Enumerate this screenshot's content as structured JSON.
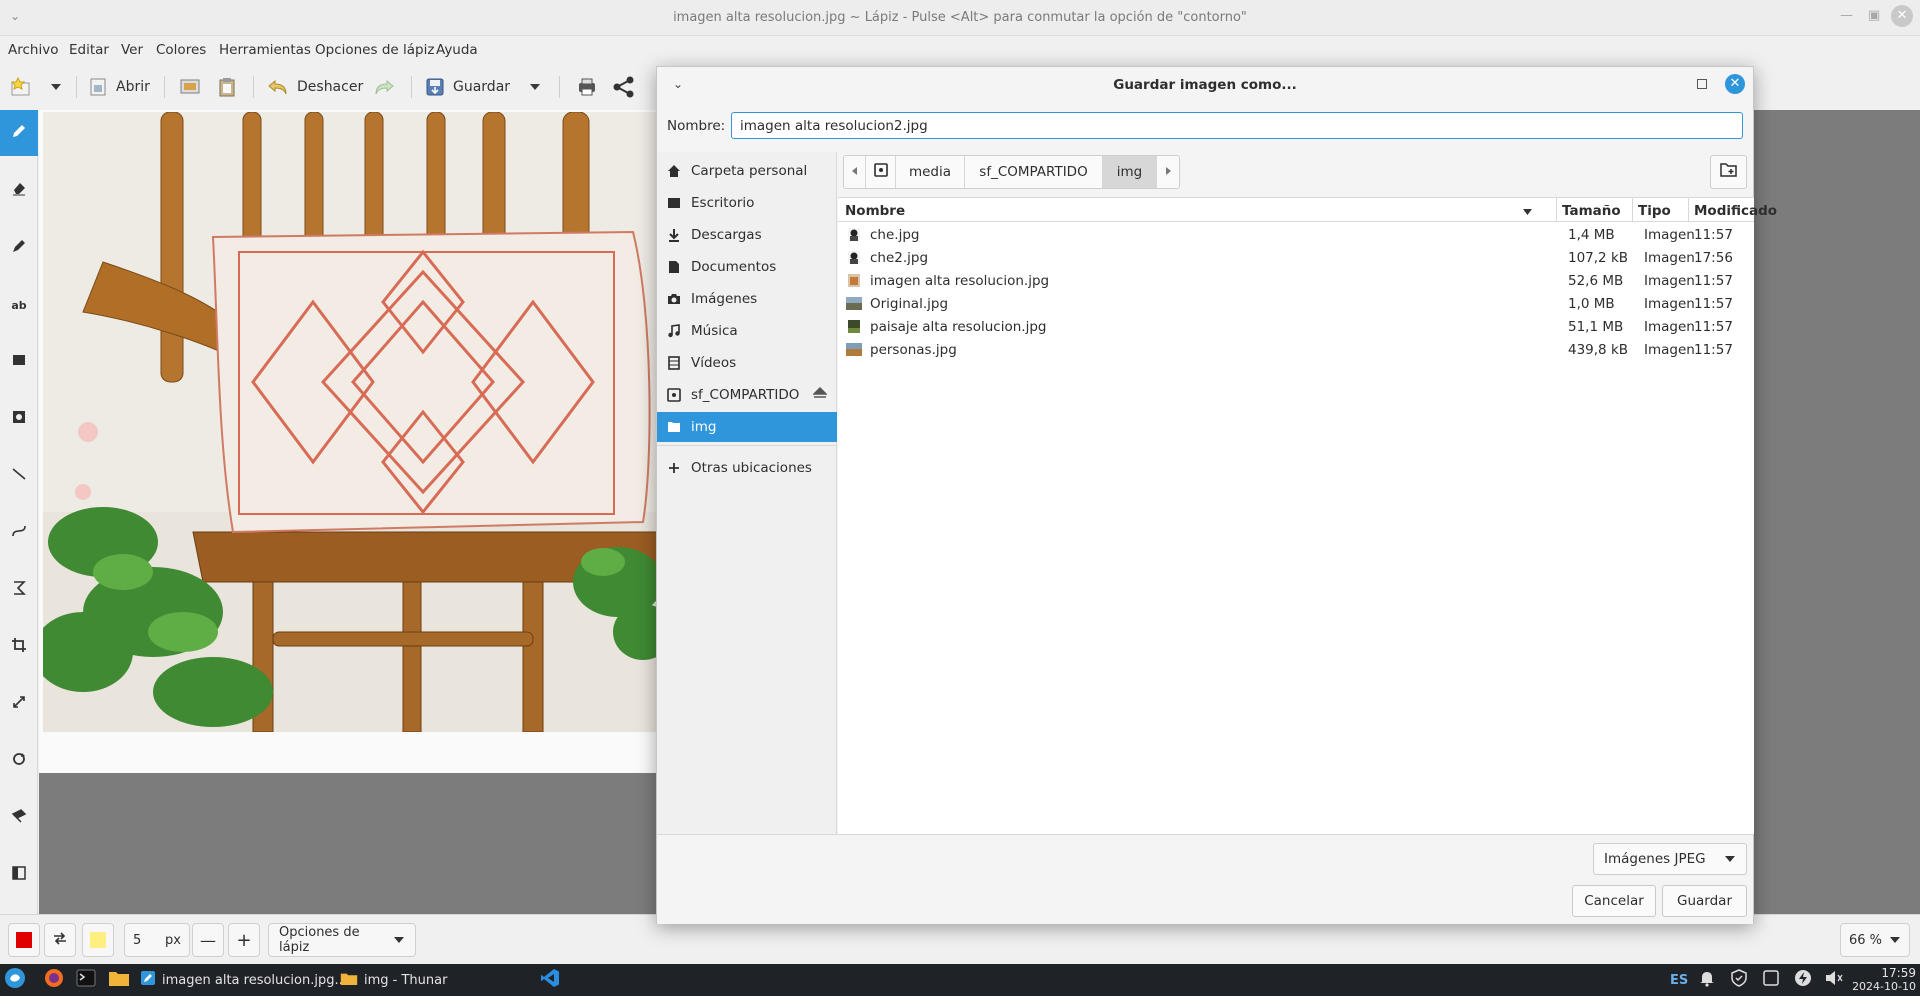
{
  "window": {
    "title": "imagen alta resolucion.jpg ~ Lápiz - Pulse <Alt> para conmutar la opción de \"contorno\""
  },
  "menu": [
    "Archivo",
    "Editar",
    "Ver",
    "Colores",
    "Herramientas",
    "Opciones de lápiz",
    "Ayuda"
  ],
  "toolbar": {
    "open_label": "Abrir",
    "undo_label": "Deshacer",
    "save_label": "Guardar"
  },
  "tools": [
    "pencil-tool",
    "eraser-tool",
    "highlighter-tool",
    "text-tool",
    "rectangle-tool",
    "shape-tool",
    "line-tool",
    "curve-tool",
    "scale-tool",
    "crop-tool",
    "resize-tool",
    "rotate-tool",
    "skew-tool",
    "filters-tool"
  ],
  "options_bar": {
    "size_value": "5",
    "size_unit": "px",
    "tool_options_label": "Opciones de lápiz",
    "zoom_value": "66 %",
    "primary_color": "#e00000",
    "secondary_color": "#ffee80"
  },
  "dialog": {
    "title": "Guardar imagen como...",
    "name_label": "Nombre:",
    "name_value": "imagen alta resolucion2.jpg",
    "places": [
      {
        "label": "Carpeta personal",
        "icon": "home-icon"
      },
      {
        "label": "Escritorio",
        "icon": "desktop-icon"
      },
      {
        "label": "Descargas",
        "icon": "download-icon"
      },
      {
        "label": "Documentos",
        "icon": "document-icon"
      },
      {
        "label": "Imágenes",
        "icon": "camera-icon"
      },
      {
        "label": "Música",
        "icon": "music-icon"
      },
      {
        "label": "Vídeos",
        "icon": "film-icon"
      },
      {
        "label": "sf_COMPARTIDO",
        "icon": "drive-icon"
      },
      {
        "label": "img",
        "icon": "folder-icon",
        "selected": true
      },
      {
        "label": "Otras ubicaciones",
        "icon": "plus-icon"
      }
    ],
    "path": [
      "media",
      "sf_COMPARTIDO",
      "img"
    ],
    "columns": {
      "name": "Nombre",
      "size": "Tamaño",
      "type": "Tipo",
      "modified": "Modificado"
    },
    "files": [
      {
        "name": "che.jpg",
        "size": "1,4 MB",
        "type": "Imagen",
        "modified": "11:57"
      },
      {
        "name": "che2.jpg",
        "size": "107,2 kB",
        "type": "Imagen",
        "modified": "17:56"
      },
      {
        "name": "imagen alta resolucion.jpg",
        "size": "52,6 MB",
        "type": "Imagen",
        "modified": "11:57"
      },
      {
        "name": "Original.jpg",
        "size": "1,0 MB",
        "type": "Imagen",
        "modified": "11:57"
      },
      {
        "name": "paisaje alta resolucion.jpg",
        "size": "51,1 MB",
        "type": "Imagen",
        "modified": "11:57"
      },
      {
        "name": "personas.jpg",
        "size": "439,8 kB",
        "type": "Imagen",
        "modified": "11:57"
      }
    ],
    "filter_label": "Imágenes JPEG",
    "cancel_label": "Cancelar",
    "save_label": "Guardar"
  },
  "taskbar": {
    "tasks": [
      "imagen alta resolucion.jpg...",
      "img - Thunar"
    ],
    "keyboard_layout": "ES",
    "time": "17:59",
    "date": "2024-10-10"
  },
  "accent_color": "#2f96db"
}
